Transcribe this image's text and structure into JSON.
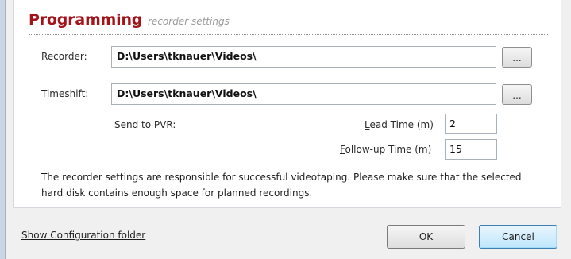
{
  "section": {
    "title": "Programming",
    "subtitle": "recorder settings"
  },
  "recorder": {
    "label": "Recorder:",
    "path": "D:\\Users\\tknauer\\Videos\\",
    "browse_label": "..."
  },
  "timeshift": {
    "label": "Timeshift:",
    "path": "D:\\Users\\tknauer\\Videos\\",
    "browse_label": "..."
  },
  "pvr": {
    "send_label": "Send to PVR:"
  },
  "lead_time": {
    "label_access": "L",
    "label_rest": "ead Time (m)",
    "value": "2"
  },
  "followup_time": {
    "label_access": "F",
    "label_rest": "ollow-up Time (m)",
    "value": "15"
  },
  "note": "The recorder settings are responsible for successful videotaping. Please make sure that the selected hard disk contains enough space for planned recordings.",
  "footer": {
    "config_link": "Show Configuration folder",
    "ok_label": "OK",
    "cancel_label": "Cancel"
  }
}
